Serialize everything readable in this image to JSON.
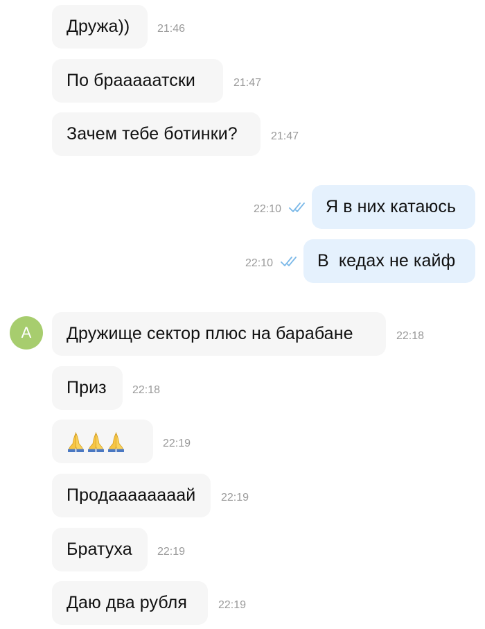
{
  "chat": {
    "avatar": {
      "initial": "A",
      "color": "#a7cd6e"
    },
    "messages": [
      {
        "text": "Дружа))",
        "time": "21:46",
        "direction": "in"
      },
      {
        "text": "По брааааатски",
        "time": "21:47",
        "direction": "in"
      },
      {
        "text": "Зачем тебе ботинки?",
        "time": "21:47",
        "direction": "in"
      },
      {
        "text": "Я в них катаюсь",
        "time": "22:10",
        "direction": "out",
        "status": "read"
      },
      {
        "text": "В  кедах не кайф",
        "time": "22:10",
        "direction": "out",
        "status": "read"
      },
      {
        "text": "Дружище сектор плюс на барабане",
        "time": "22:18",
        "direction": "in"
      },
      {
        "text": "Приз",
        "time": "22:18",
        "direction": "in"
      },
      {
        "text": "🙏🙏🙏",
        "time": "22:19",
        "direction": "in",
        "emoji": "folded-hands"
      },
      {
        "text": "Продаааааааай",
        "time": "22:19",
        "direction": "in"
      },
      {
        "text": "Братуха",
        "time": "22:19",
        "direction": "in"
      },
      {
        "text": "Даю два рубля",
        "time": "22:19",
        "direction": "in"
      }
    ]
  },
  "colors": {
    "incoming_bubble": "#f6f6f6",
    "outgoing_bubble": "#e5f1fd",
    "read_ticks": "#7ab8e8",
    "timestamp": "#9a9a9a"
  },
  "icons": {
    "read_status": "double-check-icon",
    "emoji": "folded-hands-icon"
  }
}
